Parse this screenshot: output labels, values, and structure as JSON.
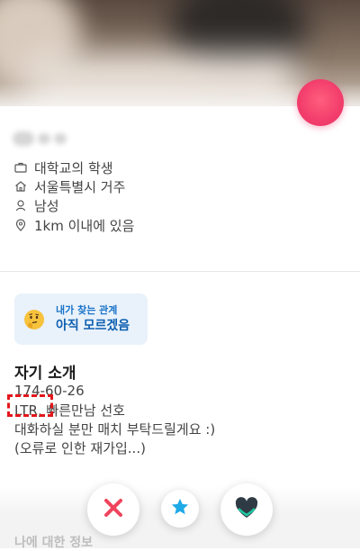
{
  "profile": {
    "info": [
      {
        "icon": "briefcase-icon",
        "text": "대학교의 학생"
      },
      {
        "icon": "home-icon",
        "text": "서울특별시 거주"
      },
      {
        "icon": "person-icon",
        "text": "남성"
      },
      {
        "icon": "location-pin-icon",
        "text": "1km 이내에 있음"
      }
    ]
  },
  "relationship": {
    "label": "내가 찾는 관계",
    "value": "아직 모르겠음",
    "emoji_icon": "thinking-face-icon"
  },
  "bio": {
    "title": "자기 소개",
    "line1": "174-60-26",
    "line2": "LTR, 빠른만남 선호",
    "line3": "대화하실 분만 매치 부탁드릴게요 :)",
    "line4": "(오류로 인한 재가입...)"
  },
  "footer": {
    "next_section": "나에 대한 정보"
  },
  "actions": [
    {
      "name": "nope",
      "icon": "x-icon",
      "color": "#f0445d"
    },
    {
      "name": "super-like",
      "icon": "star-icon",
      "color": "#1fa9e6"
    },
    {
      "name": "like",
      "icon": "heart-icon",
      "color": "#2f3b44"
    }
  ],
  "colors": {
    "accent_pink": "#f23d6b",
    "relation_bg": "#e9f2fb",
    "relation_text": "#0d5fb0",
    "highlight_red": "#e3171c"
  }
}
